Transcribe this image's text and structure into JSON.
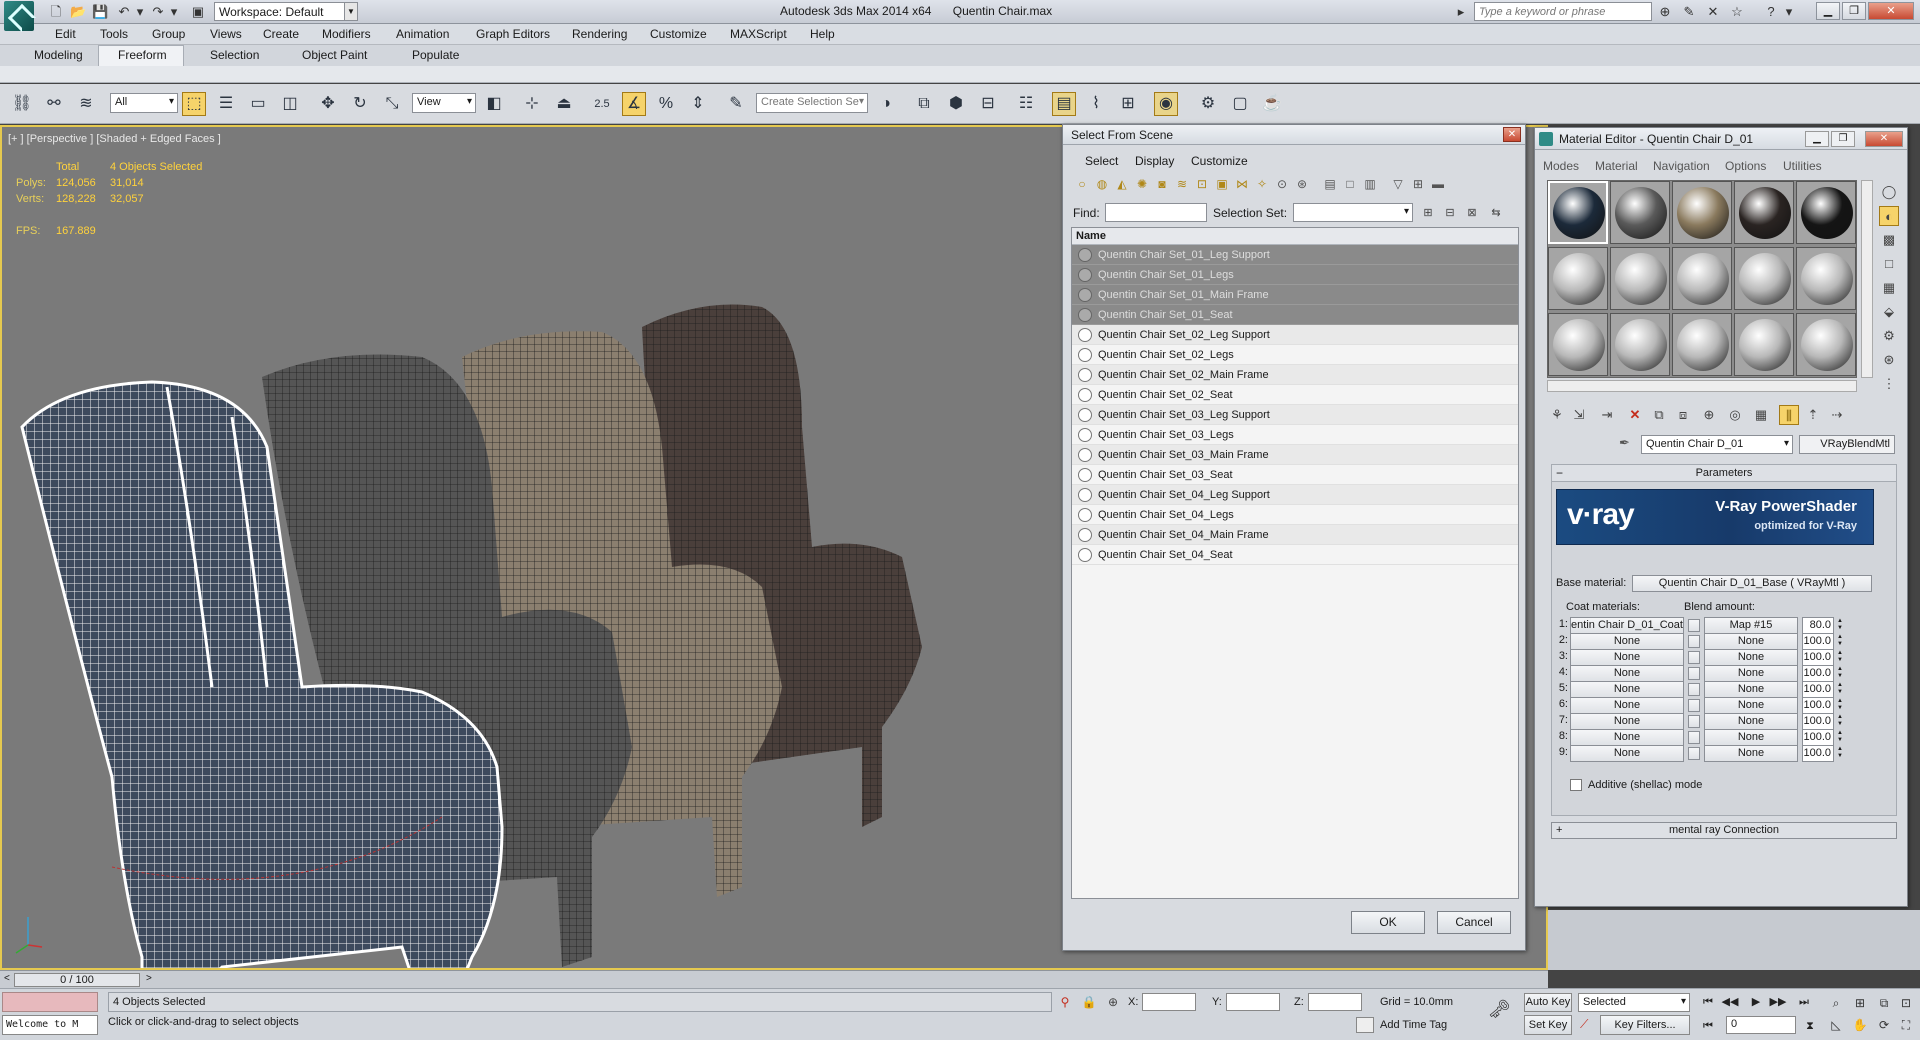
{
  "titlebar": {
    "workspace": "Workspace: Default",
    "app_name": "Autodesk 3ds Max  2014 x64",
    "file_name": "Quentin Chair.max",
    "search_placeholder": "Type a keyword or phrase"
  },
  "menubar": [
    "Edit",
    "Tools",
    "Group",
    "Views",
    "Create",
    "Modifiers",
    "Animation",
    "Graph Editors",
    "Rendering",
    "Customize",
    "MAXScript",
    "Help"
  ],
  "ribbon": {
    "tabs": [
      "Modeling",
      "Freeform",
      "Selection",
      "Object Paint",
      "Populate"
    ],
    "active": "Freeform"
  },
  "toolbar": {
    "filter": "All",
    "ref_coord": "View",
    "angle_snap_label": "2.5",
    "named_selection_placeholder": "Create Selection Se"
  },
  "viewport": {
    "label": "[+ ] [Perspective ] [Shaded + Edged Faces ]",
    "stats": {
      "total_label": "Total",
      "selected_label": "4 Objects Selected",
      "polys_label": "Polys:",
      "polys_total": "124,056",
      "polys_selected": "31,014",
      "verts_label": "Verts:",
      "verts_total": "128,228",
      "verts_selected": "32,057",
      "fps_label": "FPS:",
      "fps": "167.889"
    }
  },
  "select_from_scene": {
    "title": "Select From Scene",
    "menu": [
      "Select",
      "Display",
      "Customize"
    ],
    "find_label": "Find:",
    "selection_set_label": "Selection Set:",
    "column_name": "Name",
    "rows": [
      {
        "name": "Quentin Chair Set_01_Leg Support",
        "selected": true
      },
      {
        "name": "Quentin Chair Set_01_Legs",
        "selected": true
      },
      {
        "name": "Quentin Chair Set_01_Main Frame",
        "selected": true
      },
      {
        "name": "Quentin Chair Set_01_Seat",
        "selected": true
      },
      {
        "name": "Quentin Chair Set_02_Leg Support",
        "selected": false
      },
      {
        "name": "Quentin Chair Set_02_Legs",
        "selected": false
      },
      {
        "name": "Quentin Chair Set_02_Main Frame",
        "selected": false
      },
      {
        "name": "Quentin Chair Set_02_Seat",
        "selected": false
      },
      {
        "name": "Quentin Chair Set_03_Leg Support",
        "selected": false
      },
      {
        "name": "Quentin Chair Set_03_Legs",
        "selected": false
      },
      {
        "name": "Quentin Chair Set_03_Main Frame",
        "selected": false
      },
      {
        "name": "Quentin Chair Set_03_Seat",
        "selected": false
      },
      {
        "name": "Quentin Chair Set_04_Leg Support",
        "selected": false
      },
      {
        "name": "Quentin Chair Set_04_Legs",
        "selected": false
      },
      {
        "name": "Quentin Chair Set_04_Main Frame",
        "selected": false
      },
      {
        "name": "Quentin Chair Set_04_Seat",
        "selected": false
      }
    ],
    "ok": "OK",
    "cancel": "Cancel"
  },
  "material_editor": {
    "title": "Material Editor - Quentin Chair D_01",
    "menu": [
      "Modes",
      "Material",
      "Navigation",
      "Options",
      "Utilities"
    ],
    "material_name": "Quentin Chair D_01",
    "material_type": "VRayBlendMtl",
    "parameters_label": "Parameters",
    "vray_logo": "v·ray",
    "vray_title": "V-Ray PowerShader",
    "vray_sub": "optimized for V-Ray",
    "base_label": "Base material:",
    "base_value": "Quentin Chair D_01_Base  ( VRayMtl )",
    "coat_label": "Coat materials:",
    "blend_label": "Blend amount:",
    "coats": [
      {
        "num": "1:",
        "mat": "entin Chair D_01_Coat",
        "map": "Map #15",
        "amount": "80.0"
      },
      {
        "num": "2:",
        "mat": "None",
        "map": "None",
        "amount": "100.0"
      },
      {
        "num": "3:",
        "mat": "None",
        "map": "None",
        "amount": "100.0"
      },
      {
        "num": "4:",
        "mat": "None",
        "map": "None",
        "amount": "100.0"
      },
      {
        "num": "5:",
        "mat": "None",
        "map": "None",
        "amount": "100.0"
      },
      {
        "num": "6:",
        "mat": "None",
        "map": "None",
        "amount": "100.0"
      },
      {
        "num": "7:",
        "mat": "None",
        "map": "None",
        "amount": "100.0"
      },
      {
        "num": "8:",
        "mat": "None",
        "map": "None",
        "amount": "100.0"
      },
      {
        "num": "9:",
        "mat": "None",
        "map": "None",
        "amount": "100.0"
      }
    ],
    "additive_label": "Additive (shellac) mode",
    "mental_ray": "mental ray Connection",
    "slot_colors": [
      "#1c2a3a",
      "#5a5a5a",
      "#8a7a5e",
      "#2a2422",
      "#151515",
      "#b8b8b8",
      "#b8b8b8",
      "#b8b8b8",
      "#b8b8b8",
      "#b8b8b8",
      "#b8b8b8",
      "#b8b8b8",
      "#b8b8b8",
      "#b8b8b8",
      "#b8b8b8"
    ]
  },
  "timeline": {
    "frame": "0 / 100"
  },
  "statusbar": {
    "maxscript": "Welcome to M",
    "selection": "4 Objects Selected",
    "prompt": "Click or click-and-drag to select objects",
    "x": "X:",
    "y": "Y:",
    "z": "Z:",
    "grid": "Grid = 10.0mm",
    "add_time_tag": "Add Time Tag",
    "auto_key": "Auto Key",
    "set_key": "Set Key",
    "key_mode": "Selected",
    "key_filters": "Key Filters...",
    "current_frame": "0"
  }
}
